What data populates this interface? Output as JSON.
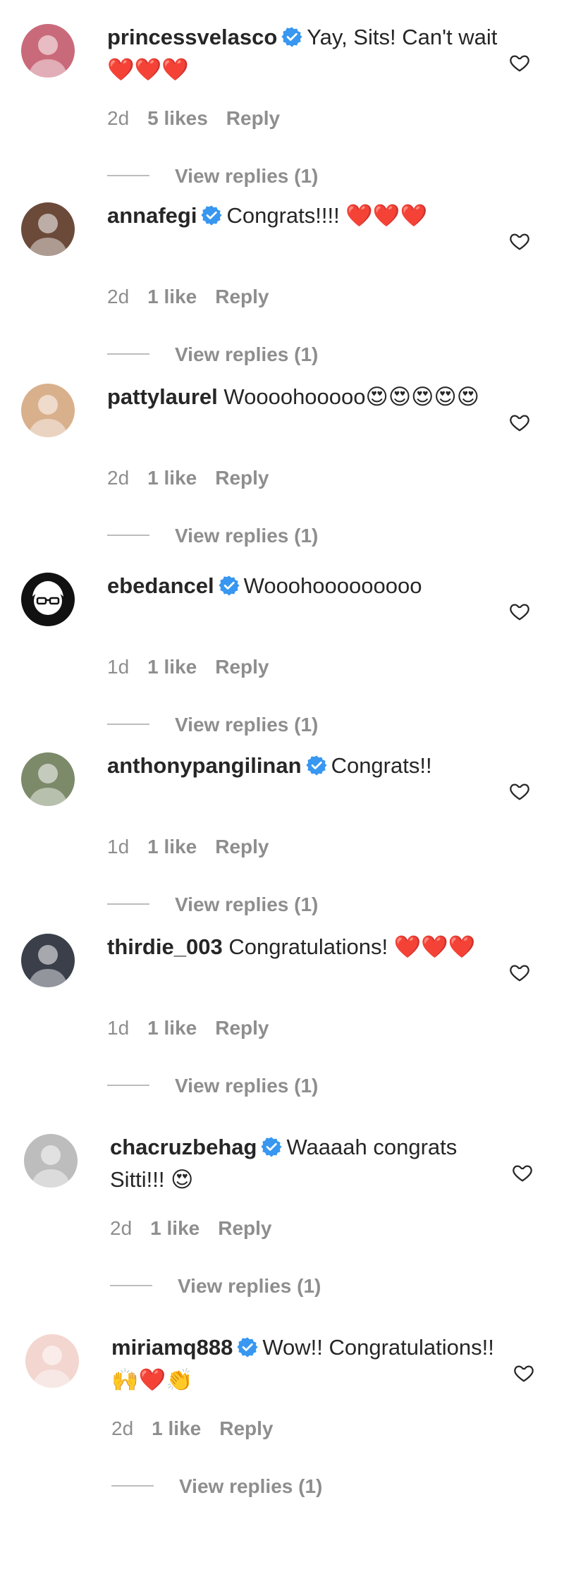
{
  "comments": [
    {
      "username": "princessvelasco",
      "verified": true,
      "text": "Yay, Sits! Can't wait ❤️❤️❤️",
      "time": "2d",
      "likes": "5 likes",
      "reply_label": "Reply",
      "view_replies": "View replies (1)",
      "avatar_color": "#c96a7a",
      "avatar_icon": "person-avatar"
    },
    {
      "username": "annafegi",
      "verified": true,
      "text": "Congrats!!!! ❤️❤️❤️",
      "time": "2d",
      "likes": "1 like",
      "reply_label": "Reply",
      "view_replies": "View replies (1)",
      "avatar_color": "#6b4a3a",
      "avatar_icon": "person-avatar"
    },
    {
      "username": "pattylaurel",
      "verified": false,
      "text": "Woooohooooo😍😍😍😍😍",
      "time": "2d",
      "likes": "1 like",
      "reply_label": "Reply",
      "view_replies": "View replies (1)",
      "avatar_color": "#d9b08c",
      "avatar_icon": "person-avatar"
    },
    {
      "username": "ebedancel",
      "verified": true,
      "text": "Wooohooooooooo",
      "time": "1d",
      "likes": "1 like",
      "reply_label": "Reply",
      "view_replies": "View replies (1)",
      "avatar_color": "#111111",
      "avatar_icon": "cartoon-glasses-avatar"
    },
    {
      "username": "anthonypangilinan",
      "verified": true,
      "text": "Congrats!!",
      "time": "1d",
      "likes": "1 like",
      "reply_label": "Reply",
      "view_replies": "View replies (1)",
      "avatar_color": "#7c8a6a",
      "avatar_icon": "person-avatar"
    },
    {
      "username": "thirdie_003",
      "verified": false,
      "text": "Congratulations! ❤️❤️❤️",
      "time": "1d",
      "likes": "1 like",
      "reply_label": "Reply",
      "view_replies": "View replies (1)",
      "avatar_color": "#3a3f4a",
      "avatar_icon": "person-avatar"
    },
    {
      "username": "chacruzbehag",
      "verified": true,
      "text": "Waaaah congrats Sitti!!! 😍",
      "time": "2d",
      "likes": "1 like",
      "reply_label": "Reply",
      "view_replies": "View replies (1)",
      "avatar_color": "#bdbdbd",
      "avatar_icon": "person-avatar"
    },
    {
      "username": "miriamq888",
      "verified": true,
      "text": "Wow!! Congratulations!!🙌❤️👏",
      "time": "2d",
      "likes": "1 like",
      "reply_label": "Reply",
      "view_replies": "View replies (1)",
      "avatar_color": "#f2d6cf",
      "avatar_icon": "person-avatar"
    }
  ],
  "colors": {
    "username": "#262626",
    "meta": "#8e8e8e",
    "verified_badge": "#3897f0"
  }
}
